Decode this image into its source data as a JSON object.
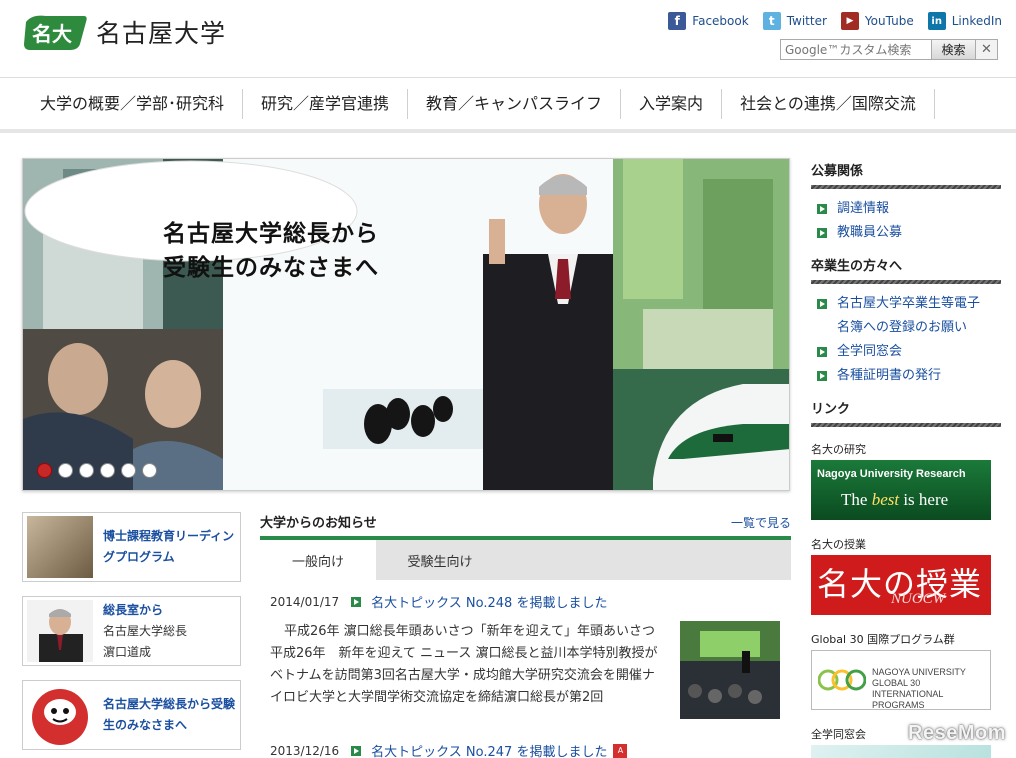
{
  "header": {
    "logo_text": "名古屋大学",
    "social": [
      {
        "label": "Facebook",
        "icon": "facebook-icon"
      },
      {
        "label": "Twitter",
        "icon": "twitter-icon"
      },
      {
        "label": "YouTube",
        "icon": "youtube-icon"
      },
      {
        "label": "LinkedIn",
        "icon": "linkedin-icon"
      }
    ],
    "search": {
      "placeholder": "Google™カスタム検索",
      "button": "検索",
      "close": "✕"
    }
  },
  "nav": [
    "大学の概要／学部･研究科",
    "研究／産学官連携",
    "教育／キャンパスライフ",
    "入学案内",
    "社会との連携／国際交流"
  ],
  "hero": {
    "line1": "名古屋大学総長から",
    "line2": "受験生のみなさまへ",
    "slides": 6,
    "active_slide": 1
  },
  "features": [
    {
      "title": "博士課程教育リーディングプログラム",
      "sub": ""
    },
    {
      "title": "総長室から",
      "sub1": "名古屋大学総長",
      "sub2": "濵口道成"
    },
    {
      "title": "名古屋大学総長から受験生のみなさまへ",
      "sub": ""
    }
  ],
  "news": {
    "title": "大学からのお知らせ",
    "more": "一覧で見る",
    "tabs": [
      "一般向け",
      "受験生向け"
    ],
    "items": [
      {
        "date": "2014/01/17",
        "link": "名大トピックス No.248 を掲載しました",
        "body": "平成26年 濵口総長年頭あいさつ「新年を迎えて」年頭あいさつ 平成26年　新年を迎えて ニュース 濵口総長と益川本学特別教授がベトナムを訪問第3回名古屋大学・成均館大学研究交流会を開催ナイロビ大学と大学間学術交流協定を締結濵口総長が第2回"
      },
      {
        "date": "2013/12/16",
        "link": "名大トピックス No.247 を掲載しました"
      }
    ]
  },
  "sidebar": {
    "sections": [
      {
        "title": "公募関係",
        "items": [
          "調達情報",
          "教職員公募"
        ]
      },
      {
        "title": "卒業生の方々へ",
        "items": [
          "名古屋大学卒業生等電子",
          "名簿への登録のお願い",
          "全学同窓会",
          "各種証明書の発行"
        ]
      },
      {
        "title": "リンク",
        "items": []
      }
    ],
    "links": [
      {
        "label": "名大の研究",
        "t1": "Nagoya University Research",
        "t2a": "The ",
        "t2b": "best",
        "t2c": " is here"
      },
      {
        "label": "名大の授業",
        "t1": "名大の授業",
        "t2": "NUOCW"
      },
      {
        "label": "Global 30 国際プログラム群",
        "t1a": "NAGOYA UNIVERSITY",
        "t1b": "GLOBAL 30",
        "t1c": "INTERNATIONAL PROGRAMS"
      },
      {
        "label": "全学同窓会"
      }
    ]
  },
  "watermark": "ReseMom"
}
